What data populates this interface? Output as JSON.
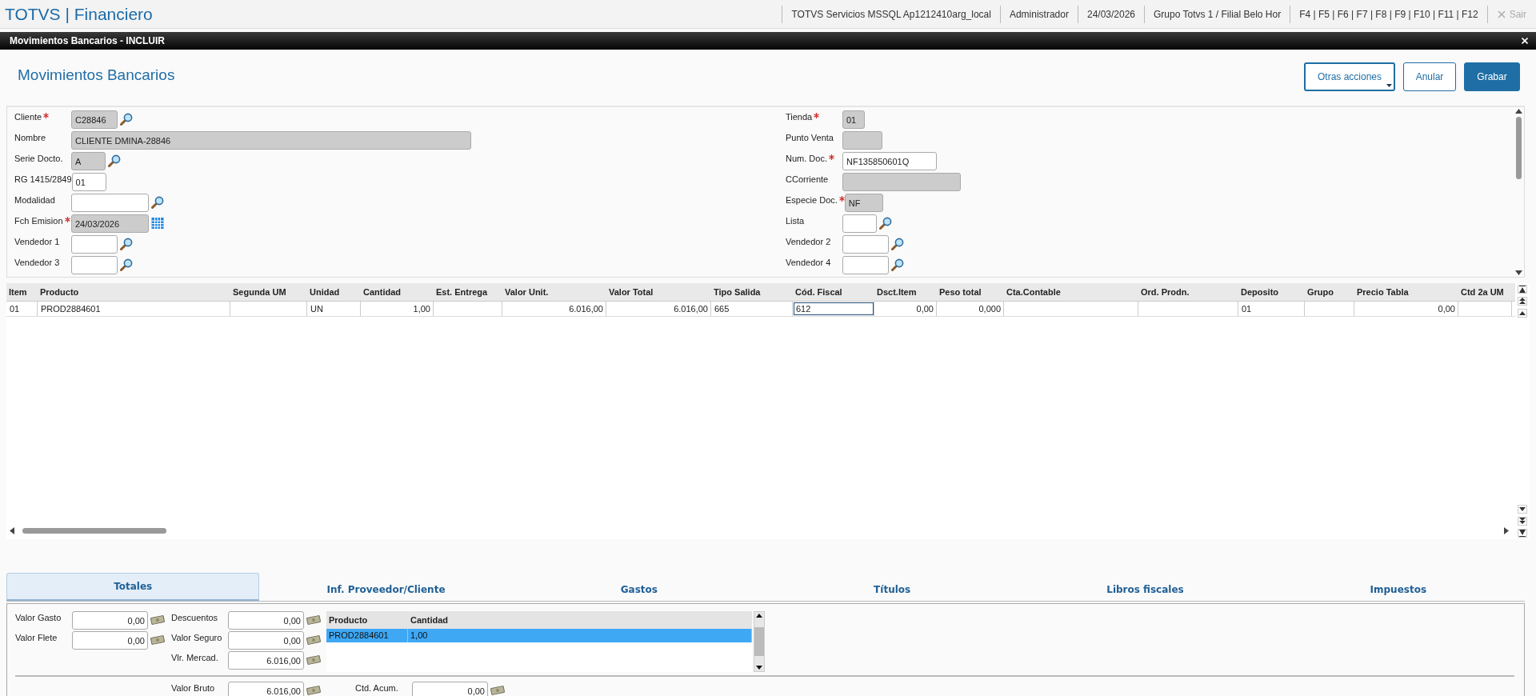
{
  "app": {
    "title": "TOTVS | Financiero",
    "status_items": [
      "TOTVS Servicios MSSQL Ap1212410arg_local",
      "Administrador",
      "24/03/2026",
      "Grupo Totvs 1 / Filial Belo Hor",
      "F4 | F5 | F6 | F7 | F8 | F9 | F10 | F11 | F12"
    ],
    "exit": {
      "label": "Sair",
      "disabled": true
    }
  },
  "dialog": {
    "title": "Movimientos Bancarios - INCLUIR",
    "heading": "Movimientos Bancarios",
    "buttons": [
      {
        "label": "Otras acciones",
        "kind": "menu"
      },
      {
        "label": "Anular",
        "kind": "outline"
      },
      {
        "label": "Grabar",
        "kind": "primary"
      }
    ]
  },
  "form": {
    "left": [
      {
        "label": "Cliente",
        "required": true,
        "value": "C28846",
        "readonly": true,
        "kind": "lookup"
      },
      {
        "label": "Nombre",
        "required": false,
        "value": "CLIENTE DMINA-28846",
        "readonly": true,
        "kind": "plain"
      },
      {
        "label": "Serie Docto.",
        "required": false,
        "value": "A",
        "readonly": true,
        "kind": "lookup"
      },
      {
        "label": "RG 1415/2849",
        "required": false,
        "value": "01",
        "readonly": false,
        "kind": "plain"
      },
      {
        "label": "Modalidad",
        "required": false,
        "readonly": false,
        "kind": "lookup"
      },
      {
        "label": "Fch Emision",
        "required": true,
        "value": "24/03/2026",
        "readonly": true,
        "kind": "date"
      },
      {
        "label": "Vendedor 1",
        "required": false,
        "readonly": false,
        "kind": "lookup"
      },
      {
        "label": "Vendedor 3",
        "required": false,
        "readonly": false,
        "kind": "lookup"
      }
    ],
    "right": [
      {
        "label": "Tienda",
        "required": true,
        "value": "01",
        "readonly": true,
        "kind": "plain"
      },
      {
        "label": "Punto Venta",
        "required": false,
        "readonly": true,
        "kind": "plain"
      },
      {
        "label": "Num. Doc.",
        "required": true,
        "value": "NF135850601Q",
        "readonly": false,
        "kind": "plain"
      },
      {
        "label": "CCorriente",
        "required": false,
        "readonly": true,
        "kind": "plain"
      },
      {
        "label": "Especie Doc.",
        "required": true,
        "value": "NF",
        "readonly": true,
        "kind": "plain"
      },
      {
        "label": "Lista",
        "required": false,
        "readonly": false,
        "kind": "lookup"
      },
      {
        "label": "Vendedor 2",
        "required": false,
        "readonly": false,
        "kind": "lookup"
      },
      {
        "label": "Vendedor 4",
        "required": false,
        "readonly": false,
        "kind": "lookup"
      }
    ]
  },
  "items_table": {
    "columns": [
      {
        "label": "Item",
        "kind": "text"
      },
      {
        "label": "Producto",
        "kind": "text"
      },
      {
        "label": "Segunda UM",
        "kind": "text"
      },
      {
        "label": "Unidad",
        "kind": "text"
      },
      {
        "label": "Cantidad",
        "kind": "number"
      },
      {
        "label": "Est. Entrega",
        "kind": "text"
      },
      {
        "label": "Valor Unit.",
        "kind": "number"
      },
      {
        "label": "Valor Total",
        "kind": "number"
      },
      {
        "label": "Tipo Salida",
        "kind": "text"
      },
      {
        "label": "Cód. Fiscal",
        "kind": "text"
      },
      {
        "label": "Dsct.Item",
        "kind": "number"
      },
      {
        "label": "Peso total",
        "kind": "number"
      },
      {
        "label": "Cta.Contable",
        "kind": "text"
      },
      {
        "label": "Ord. Prodn.",
        "kind": "text"
      },
      {
        "label": "Deposito",
        "kind": "text"
      },
      {
        "label": "Grupo",
        "kind": "text"
      },
      {
        "label": "Precio Tabla",
        "kind": "number"
      },
      {
        "label": "Ctd 2a UM",
        "kind": "text"
      }
    ],
    "rows": [
      {
        "cells": [
          {
            "text": "01",
            "focused": false
          },
          {
            "text": "PROD2884601",
            "focused": false
          },
          {
            "focused": false
          },
          {
            "text": "UN",
            "focused": false
          },
          {
            "text": "1,00",
            "focused": false
          },
          {
            "focused": false
          },
          {
            "text": "6.016,00",
            "focused": false
          },
          {
            "text": "6.016,00",
            "focused": false
          },
          {
            "text": "665",
            "focused": false
          },
          {
            "text": "612",
            "focused": true
          },
          {
            "text": "0,00",
            "focused": false
          },
          {
            "text": "0,000",
            "focused": false
          },
          {
            "focused": false
          },
          {
            "focused": false
          },
          {
            "text": "01",
            "focused": false
          },
          {
            "focused": false
          },
          {
            "text": "0,00",
            "focused": false
          },
          {
            "focused": false
          }
        ]
      }
    ]
  },
  "tabs": [
    {
      "label": "Totales",
      "selected": true
    },
    {
      "label": "Inf. Proveedor/Cliente",
      "selected": false
    },
    {
      "label": "Gastos",
      "selected": false
    },
    {
      "label": "Títulos",
      "selected": false
    },
    {
      "label": "Libros fiscales",
      "selected": false
    },
    {
      "label": "Impuestos",
      "selected": false
    }
  ],
  "totals": {
    "left": [
      {
        "label": "Valor Gasto",
        "value": "0,00"
      },
      {
        "label": "Valor Flete",
        "value": "0,00"
      }
    ],
    "middle": [
      {
        "label": "Descuentos",
        "value": "0,00"
      },
      {
        "label": "Valor Seguro",
        "value": "0,00"
      },
      {
        "label": "Vlr. Mercad.",
        "value": "6.016,00"
      }
    ],
    "product_table": {
      "columns": [
        "Producto",
        "Cantidad"
      ],
      "rows": [
        {
          "cells": [
            "PROD2884601",
            "1,00"
          ],
          "selected": true
        }
      ]
    },
    "footer": [
      {
        "label": "Valor Bruto",
        "value": "6.016,00"
      },
      {
        "label": "Ctd. Acum.",
        "value": "0,00"
      }
    ]
  }
}
